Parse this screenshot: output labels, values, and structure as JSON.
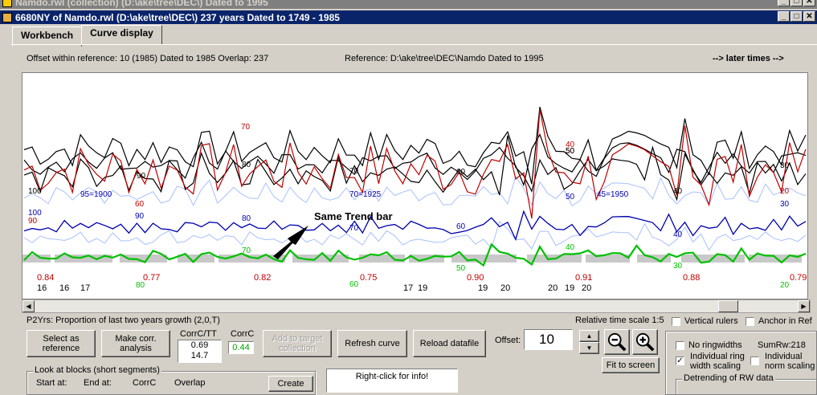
{
  "window_back": {
    "title": "Namdo.rwl (collection)  (D:\\ake\\tree\\DEC\\)  Dated to 1995"
  },
  "window_main": {
    "title": "6680NY of Namdo.rwl    (D:\\ake\\tree\\DEC\\)  237 years  Dated to 1749 - 1985"
  },
  "window_buttons": {
    "minimize": "_",
    "maximize": "□",
    "close": "✕"
  },
  "tabs": [
    {
      "label": "Workbench"
    },
    {
      "label": "Curve display"
    }
  ],
  "info": {
    "offset_line": "Offset within reference:  10  (1985)   Dated to 1985   Overlap: 237",
    "reference_line": "Reference: D:\\ake\\tree\\DEC\\Namdo  Dated to 1995",
    "later_times": "--> later times -->"
  },
  "colors": {
    "red": "#c00000",
    "black": "#000000",
    "blue": "#0000b0",
    "lightblue": "#a8c0ff",
    "green": "#00c000",
    "bar": "#c8c8c8"
  },
  "chart_data": {
    "type": "line",
    "annotation": "Same Trend bar",
    "decade_labels": [
      "95=1900",
      "70=1925",
      "45=1950"
    ],
    "red_curve_labels": [
      "70",
      "60",
      "40",
      "50",
      "20",
      "90"
    ],
    "black_curve_labels": [
      "100",
      "90",
      "80",
      "70",
      "50",
      "60",
      "30",
      "40"
    ],
    "blue_curve_labels": [
      "100",
      "90",
      "80",
      "70",
      "60",
      "50",
      "40",
      "30"
    ],
    "green_curve_labels": [
      "80",
      "70",
      "60",
      "50",
      "40",
      "30",
      "20"
    ],
    "correlation_values": [
      "0.84",
      "0.77",
      "0.82",
      "0.75",
      "0.90",
      "0.91",
      "0.88",
      "0.79"
    ],
    "year_markers": [
      "16",
      "16",
      "17",
      "17",
      "19",
      "19",
      "20",
      "20",
      "19",
      "20"
    ]
  },
  "p2yrs_label": "P2Yrs: Proportion of last two years growth (2,0,T)",
  "relative_time_scale": "Relative time scale 1:5",
  "checkboxes": {
    "vertical_rulers": {
      "label": "Vertical rulers",
      "checked": ""
    },
    "anchor_in_ref": {
      "label": "Anchor in Ref",
      "checked": ""
    },
    "no_ringwidths": {
      "label": "No ringwidths",
      "checked": ""
    },
    "individual_ring_width": {
      "label": "Individual ring width scaling",
      "checked": "✓"
    },
    "individual_norm": {
      "label": "Individual norm scaling",
      "checked": ""
    }
  },
  "buttons": {
    "select_reference": "Select as reference",
    "make_corr": "Make corr. analysis",
    "add_to_target": "Add to target collection",
    "refresh_curve": "Refresh curve",
    "reload_datafile": "Reload datafile",
    "fit_to_screen": "Fit to screen",
    "create": "Create"
  },
  "corr": {
    "corrc_tt_label": "CorrC/TT",
    "corrc_tt_value1": "0.69",
    "corrc_tt_value2": "14.7",
    "corrc_label": "CorrC",
    "corrc_value": "0.44"
  },
  "offset": {
    "label": "Offset:",
    "value": "10"
  },
  "sumrw": "SumRw:218",
  "detrending": {
    "title": "Detrending of RW data"
  },
  "blocks": {
    "title": "Look at blocks (short segments)",
    "headers": [
      "Start at:",
      "End at:",
      "CorrC",
      "Overlap"
    ]
  },
  "right_click": "Right-click for info!",
  "zoom": {
    "out_icon": "zoom-out",
    "in_icon": "zoom-in"
  }
}
